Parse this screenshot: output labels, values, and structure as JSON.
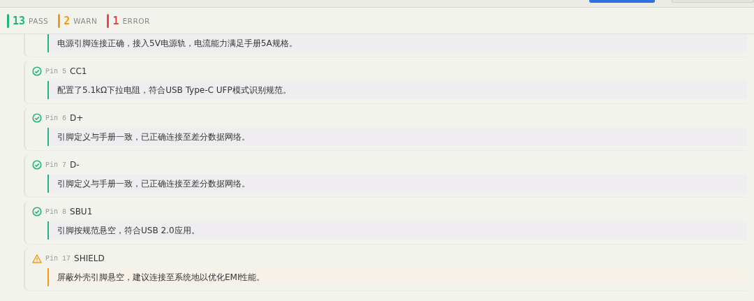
{
  "summary": [
    {
      "kind": "pass",
      "count": "13",
      "label": "PASS"
    },
    {
      "kind": "warn",
      "count": "2",
      "label": "WARN"
    },
    {
      "kind": "error",
      "count": "1",
      "label": "ERROR"
    }
  ],
  "pins": [
    {
      "kind": "pass",
      "message": "电源引脚连接正确，接入5V电源轨，电流能力满足手册5A规格。"
    },
    {
      "kind": "pass",
      "pin": "Pin 5",
      "name": "CC1",
      "message": "配置了5.1kΩ下拉电阻，符合USB Type-C UFP模式识别规范。"
    },
    {
      "kind": "pass",
      "pin": "Pin 6",
      "name": "D+",
      "message": "引脚定义与手册一致，已正确连接至差分数据网络。"
    },
    {
      "kind": "pass",
      "pin": "Pin 7",
      "name": "D-",
      "message": "引脚定义与手册一致，已正确连接至差分数据网络。"
    },
    {
      "kind": "pass",
      "pin": "Pin 8",
      "name": "SBU1",
      "message": "引脚按规范悬空，符合USB 2.0应用。"
    },
    {
      "kind": "warn",
      "pin": "Pin 17",
      "name": "SHIELD",
      "message": "屏蔽外壳引脚悬空，建议连接至系统地以优化EMI性能。"
    }
  ]
}
